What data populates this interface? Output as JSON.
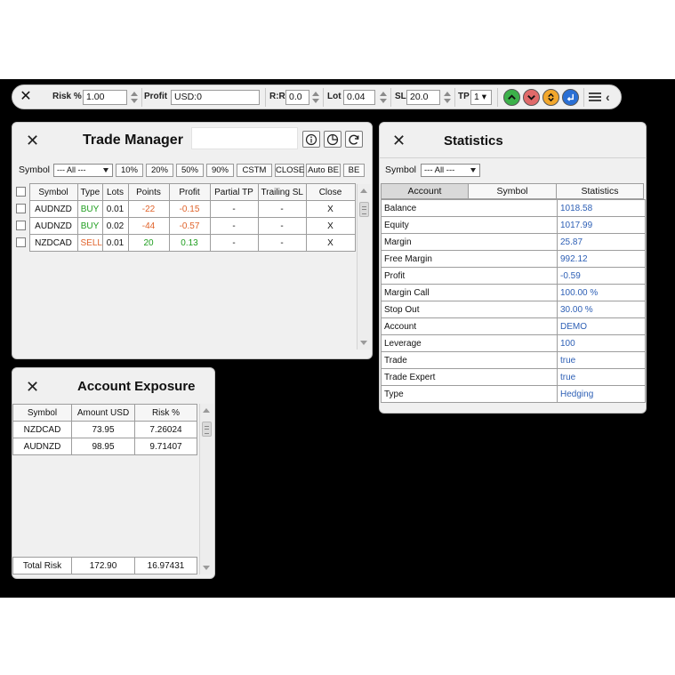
{
  "toolbar": {
    "close": "✕",
    "risk_label": "Risk %",
    "risk_value": "1.00",
    "profit_label": "Profit",
    "profit_value": "USD:0",
    "rr_label": "R:R",
    "rr_value": "0.0",
    "lot_label": "Lot",
    "lot_value": "0.04",
    "sl_label": "SL",
    "sl_value": "20.0",
    "tp_label": "TP",
    "tp_value": "1 ▾",
    "buttons": [
      {
        "name": "buy-up",
        "color": "#3cb14a"
      },
      {
        "name": "sell-down",
        "color": "#e06a6a"
      },
      {
        "name": "swap",
        "color": "#f2a72c"
      },
      {
        "name": "enter",
        "color": "#2a6fd4"
      }
    ]
  },
  "trade_manager": {
    "title": "Trade Manager",
    "close": "✕",
    "symbol_label": "Symbol",
    "symbol_filter": "--- All ---",
    "buttons": [
      "10%",
      "20%",
      "50%",
      "90%",
      "CSTM",
      "CLOSE",
      "Auto BE",
      "BE"
    ],
    "columns": [
      "Symbol",
      "Type",
      "Lots",
      "Points",
      "Profit",
      "Partial TP",
      "Trailing SL",
      "Close"
    ],
    "rows": [
      {
        "symbol": "AUDNZD",
        "type": "BUY",
        "lots": "0.01",
        "points": "-22",
        "profit": "-0.15",
        "partial_tp": "-",
        "trailing_sl": "-",
        "close": "X"
      },
      {
        "symbol": "AUDNZD",
        "type": "BUY",
        "lots": "0.02",
        "points": "-44",
        "profit": "-0.57",
        "partial_tp": "-",
        "trailing_sl": "-",
        "close": "X"
      },
      {
        "symbol": "NZDCAD",
        "type": "SELL",
        "lots": "0.01",
        "points": "20",
        "profit": "0.13",
        "partial_tp": "-",
        "trailing_sl": "-",
        "close": "X"
      }
    ]
  },
  "statistics": {
    "title": "Statistics",
    "close": "✕",
    "symbol_label": "Symbol",
    "symbol_filter": "--- All ---",
    "tabs": [
      "Account",
      "Symbol",
      "Statistics"
    ],
    "rows": [
      {
        "label": "Balance",
        "value": "1018.58"
      },
      {
        "label": "Equity",
        "value": "1017.99"
      },
      {
        "label": "Margin",
        "value": "25.87"
      },
      {
        "label": "Free Margin",
        "value": "992.12"
      },
      {
        "label": "Profit",
        "value": "-0.59"
      },
      {
        "label": "Margin Call",
        "value": "100.00 %"
      },
      {
        "label": "Stop Out",
        "value": "30.00 %"
      },
      {
        "label": "Account",
        "value": "DEMO"
      },
      {
        "label": "Leverage",
        "value": "100"
      },
      {
        "label": "Trade",
        "value": "true"
      },
      {
        "label": "Trade Expert",
        "value": "true"
      },
      {
        "label": "Type",
        "value": "Hedging"
      }
    ]
  },
  "exposure": {
    "title": "Account Exposure",
    "close": "✕",
    "columns": [
      "Symbol",
      "Amount USD",
      "Risk %"
    ],
    "rows": [
      {
        "symbol": "NZDCAD",
        "amount": "73.95",
        "risk": "7.26024"
      },
      {
        "symbol": "AUDNZD",
        "amount": "98.95",
        "risk": "9.71407"
      }
    ],
    "total": {
      "label": "Total Risk",
      "amount": "172.90",
      "risk": "16.97431"
    }
  },
  "colors": {
    "buy": "#1f9e1f",
    "sell": "#e0632b",
    "negative": "#e0632b",
    "positive": "#1f9e1f",
    "stat_value": "#2d5fb5"
  }
}
